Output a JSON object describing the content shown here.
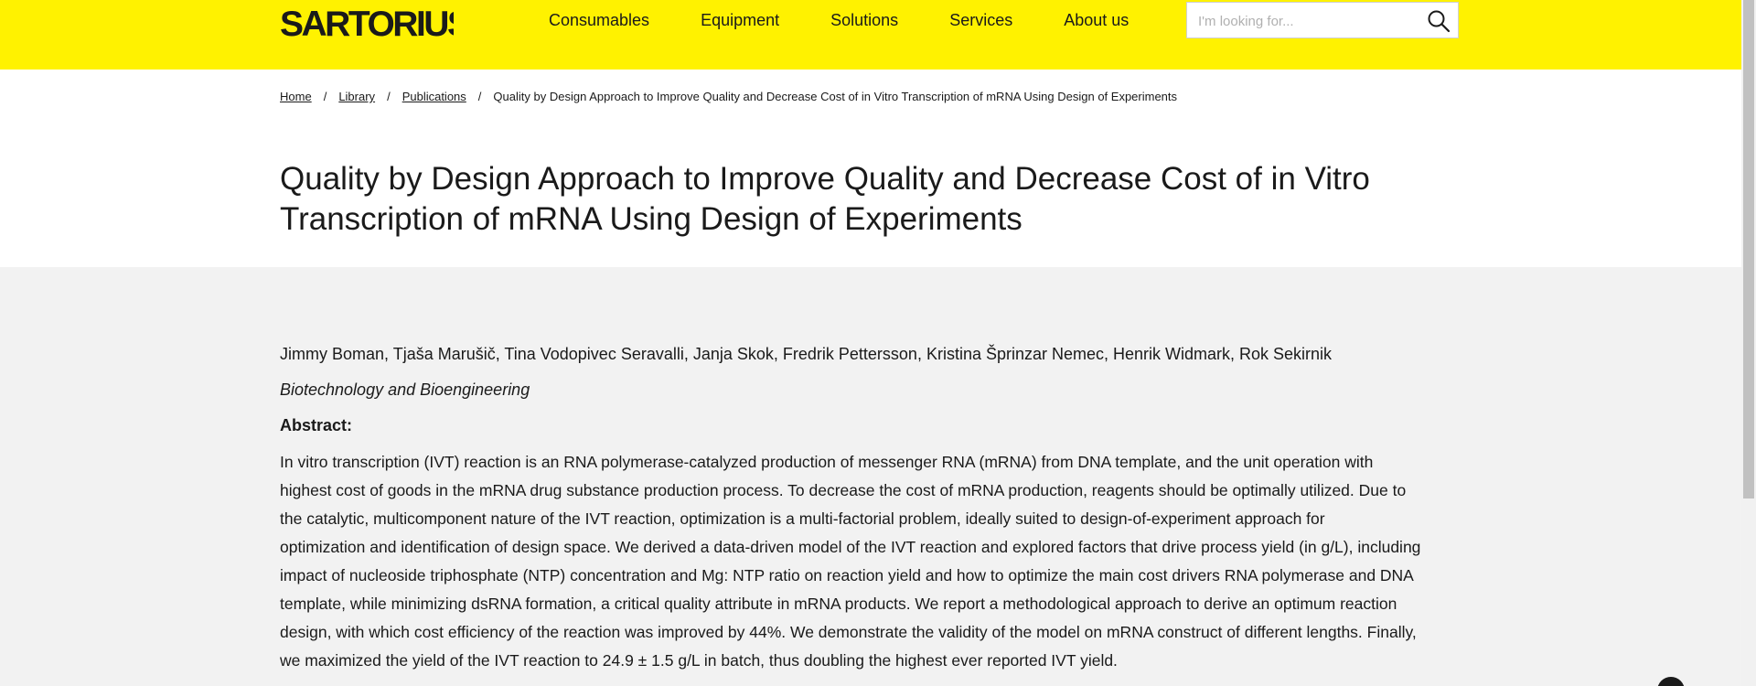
{
  "header": {
    "brand": "SARTORIUS",
    "nav": [
      "Consumables",
      "Equipment",
      "Solutions",
      "Services",
      "About us"
    ],
    "search_placeholder": "I'm looking for..."
  },
  "breadcrumb": {
    "items": [
      "Home",
      "Library",
      "Publications"
    ],
    "current": "Quality by Design Approach to Improve Quality and Decrease Cost of in Vitro Transcription of mRNA Using Design of Experiments"
  },
  "title_line1": "Quality by Design Approach to Improve Quality and Decrease Cost of in Vitro",
  "title_line2": "Transcription of mRNA Using Design of Experiments",
  "publication": {
    "authors": "Jimmy Boman, Tjaša Marušič, Tina Vodopivec Seravalli, Janja Skok, Fredrik Pettersson, Kristina Šprinzar Nemec, Henrik Widmark, Rok Sekirnik",
    "journal": "Biotechnology and Bioengineering",
    "abstract_label": "Abstract:",
    "abstract_lines": [
      "In vitro transcription (IVT) reaction is an RNA polymerase-catalyzed production of messenger RNA (mRNA) from DNA template, and the unit operation with",
      "highest cost of goods in the mRNA drug substance production process. To decrease the cost of mRNA production, reagents should be optimally utilized. Due to",
      "the catalytic, multicomponent nature of the IVT reaction, optimization is a multi-factorial problem, ideally suited to design-of-experiment approach for",
      "optimization and identification of design space. We derived a data-driven model of the IVT reaction and explored factors that drive process yield (in g/L), including",
      "impact of nucleoside triphosphate (NTP) concentration and Mg: NTP ratio on reaction yield and how to optimize the main cost drivers RNA polymerase and DNA",
      "template, while minimizing dsRNA formation, a critical quality attribute in mRNA products. We report a methodological approach to derive an optimum reaction",
      "design, with which cost efficiency of the reaction was improved by 44%. We demonstrate the validity of the model on mRNA construct of different lengths. Finally,",
      "we maximized the yield of the IVT reaction to 24.9 ± 1.5 g/L in batch, thus doubling the highest ever reported IVT yield."
    ]
  },
  "colors": {
    "brand_yellow": "#fff200",
    "content_bg": "#f2f2f2",
    "text": "#1a1a1a"
  },
  "icons": {
    "search": "search-icon",
    "logo": "sartorius-logo"
  }
}
